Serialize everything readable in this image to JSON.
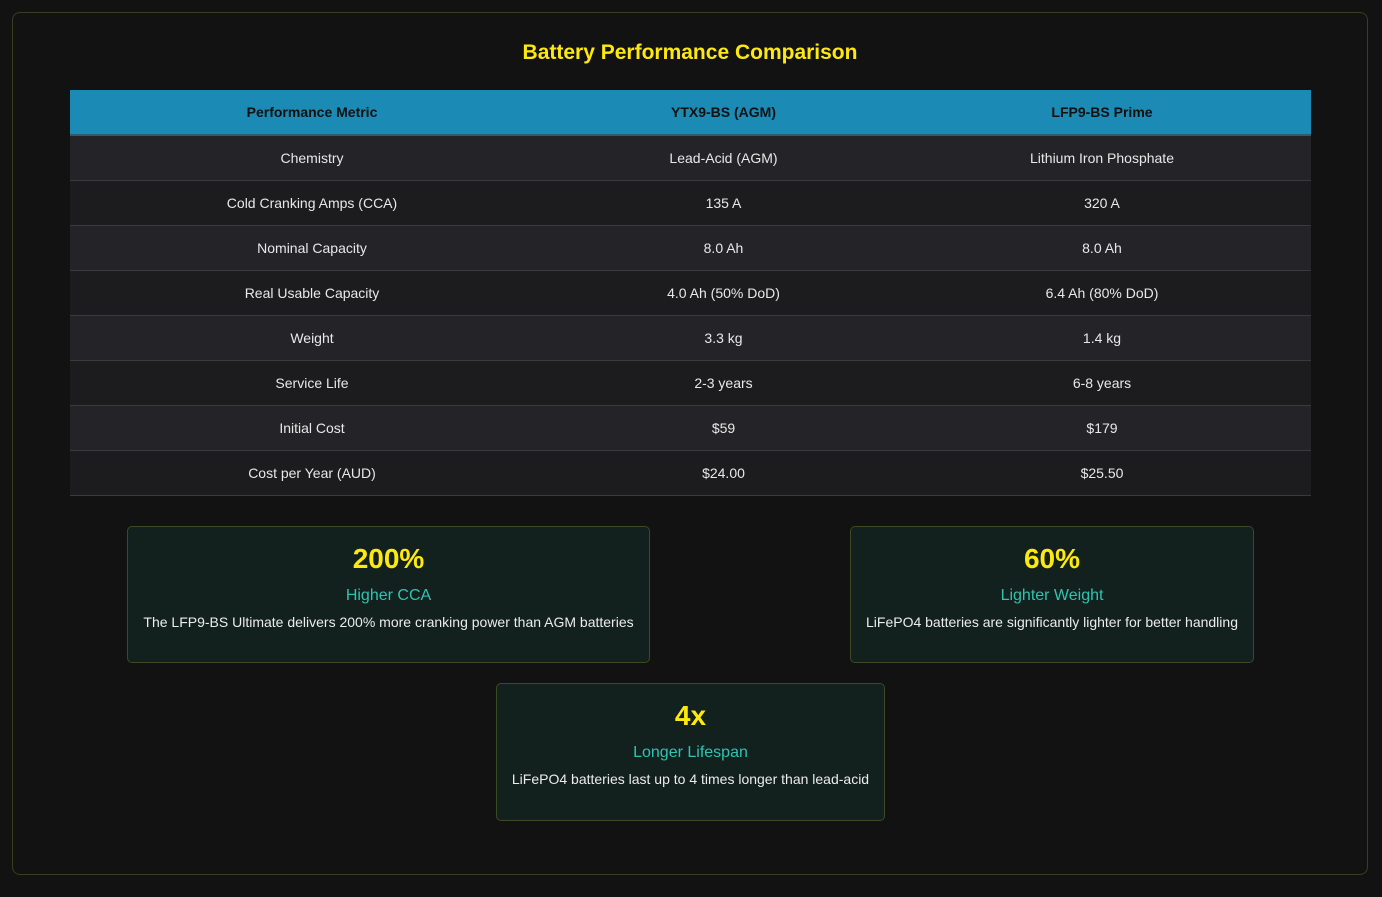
{
  "title": "Battery Performance Comparison",
  "table": {
    "headers": [
      "Performance Metric",
      "YTX9-BS (AGM)",
      "LFP9-BS Prime"
    ],
    "rows": [
      [
        "Chemistry",
        "Lead-Acid (AGM)",
        "Lithium Iron Phosphate"
      ],
      [
        "Cold Cranking Amps (CCA)",
        "135 A",
        "320 A"
      ],
      [
        "Nominal Capacity",
        "8.0 Ah",
        "8.0 Ah"
      ],
      [
        "Real Usable Capacity",
        "4.0 Ah (50% DoD)",
        "6.4 Ah (80% DoD)"
      ],
      [
        "Weight",
        "3.3 kg",
        "1.4 kg"
      ],
      [
        "Service Life",
        "2-3 years",
        "6-8 years"
      ],
      [
        "Initial Cost",
        "$59",
        "$179"
      ],
      [
        "Cost per Year (AUD)",
        "$24.00",
        "$25.50"
      ]
    ]
  },
  "cards": [
    {
      "value": "200%",
      "label": "Higher CCA",
      "desc": "The LFP9-BS Ultimate delivers 200% more cranking power than AGM batteries"
    },
    {
      "value": "60%",
      "label": "Lighter Weight",
      "desc": "LiFePO4 batteries are significantly lighter for better handling"
    },
    {
      "value": "4x",
      "label": "Longer Lifespan",
      "desc": "LiFePO4 batteries last up to 4 times longer than lead-acid"
    }
  ],
  "colors": {
    "title": "#fde910",
    "header_bg": "#1b8ab4",
    "accent": "#2ec4b0"
  }
}
